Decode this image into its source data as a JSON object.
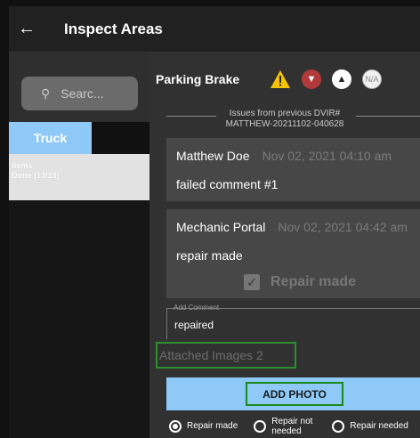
{
  "appbar": {
    "back_icon": "arrow-left-icon",
    "title": "Inspect Areas"
  },
  "sidebar": {
    "search_placeholder": "Searc...",
    "tab_truck": "Truck",
    "items_label": "Items",
    "items_done": "Done (13/13)"
  },
  "item": {
    "title": "Parking Brake",
    "icons": [
      "warning-icon",
      "thumbs-down-icon",
      "thumbs-up-icon",
      "na-icon"
    ],
    "na_label": "N/A",
    "issues_line1": "Issues from previous DVIR#",
    "issues_line2": "MATTHEW-20211102-040628"
  },
  "cards": [
    {
      "name": "Matthew Doe",
      "date": "Nov 02, 2021 04:10 am",
      "comment": "failed comment #1"
    },
    {
      "name": "Mechanic Portal",
      "date": "Nov 02, 2021 04:42 am",
      "comment": "repair made",
      "checkbox_label": "Repair made"
    }
  ],
  "add_comment": {
    "label": "Add Comment",
    "value": "repaired"
  },
  "attached_images": "Attached Images 2",
  "add_photo": "ADD PHOTO",
  "radio_options": [
    {
      "label": "Repair made",
      "selected": true
    },
    {
      "label": "Repair not needed",
      "selected": false
    },
    {
      "label": "Repair needed",
      "selected": false
    }
  ],
  "colors": {
    "accent_blue": "#8ec9f8",
    "highlight_green": "#2d8f2d",
    "warning_yellow": "#f5c400",
    "down_red": "#b23a3a"
  }
}
